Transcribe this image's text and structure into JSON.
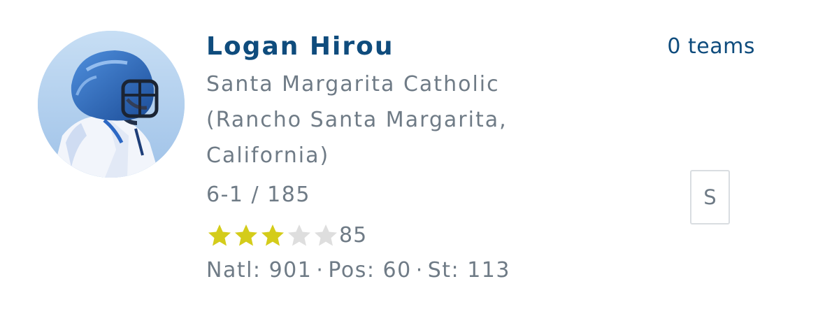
{
  "player": {
    "name": "Logan Hirou",
    "school_lines": [
      "Santa Margarita Catholic",
      "(Rancho Santa Margarita,",
      "California)"
    ],
    "measurements": "6-1 / 185",
    "rating": "85",
    "stars": {
      "filled": 3,
      "total": 5,
      "filled_color": "#d4cc1a",
      "empty_color": "#dedede"
    },
    "rankings": {
      "natl": "Natl: 901",
      "pos": "Pos: 60",
      "st": "St: 113",
      "separator": "·"
    }
  },
  "teams_link": "0 teams",
  "action_box_label": "S",
  "colors": {
    "name": "#0f4c7d",
    "secondary_text": "#6f7b86",
    "box_border": "#d9dde1"
  },
  "icons": {
    "avatar": "player-photo-helmet"
  }
}
